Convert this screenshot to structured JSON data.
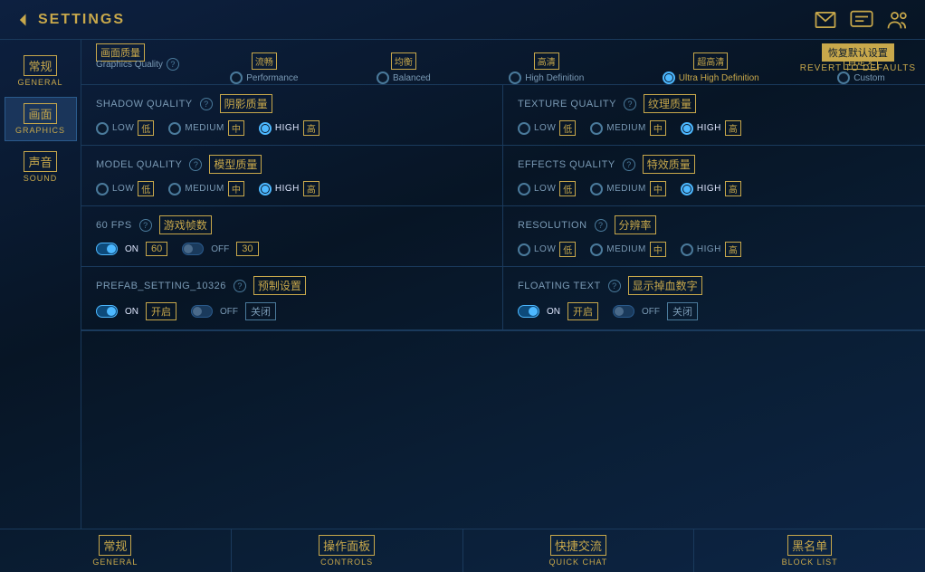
{
  "header": {
    "back_label": "SETTINGS",
    "revert_cn": "恢复默认设置",
    "revert_en": "REVERT TO DEFAULTS"
  },
  "quality_bar": {
    "label_cn": "画面质量",
    "label_en": "Graphics Quality",
    "options": [
      {
        "cn": "流畅",
        "en": "Performance",
        "active": false
      },
      {
        "cn": "均衡",
        "en": "Balanced",
        "active": false
      },
      {
        "cn": "高清",
        "en": "High Definition",
        "active": false
      },
      {
        "cn": "超高清",
        "en": "Ultra High Definition",
        "active": true
      },
      {
        "cn": "自定义",
        "en": "Custom",
        "active": false
      }
    ]
  },
  "sidebar": {
    "items": [
      {
        "cn": "常规",
        "en": "GENERAL",
        "active": false
      },
      {
        "cn": "画面",
        "en": "GRAPHICS",
        "active": true
      },
      {
        "cn": "声音",
        "en": "SOUND",
        "active": false
      }
    ]
  },
  "settings": [
    {
      "name_en": "SHADOW QUALITY",
      "name_cn": "阴影质量",
      "options": [
        {
          "en": "LOW",
          "cn": "低",
          "active": false
        },
        {
          "en": "MEDIUM",
          "cn": "中",
          "active": false
        },
        {
          "en": "HIGH",
          "cn": "高",
          "active": true
        }
      ]
    },
    {
      "name_en": "TEXTURE QUALITY",
      "name_cn": "纹理质量",
      "options": [
        {
          "en": "LOW",
          "cn": "低",
          "active": false
        },
        {
          "en": "MEDIUM",
          "cn": "中",
          "active": false
        },
        {
          "en": "HIGH",
          "cn": "高",
          "active": true
        }
      ]
    },
    {
      "name_en": "MODEL QUALITY",
      "name_cn": "模型质量",
      "options": [
        {
          "en": "LOW",
          "cn": "低",
          "active": false
        },
        {
          "en": "MEDIUM",
          "cn": "中",
          "active": false
        },
        {
          "en": "HIGH",
          "cn": "高",
          "active": true
        }
      ]
    },
    {
      "name_en": "EFFECTS QUALITY",
      "name_cn": "特效质量",
      "options": [
        {
          "en": "LOW",
          "cn": "低",
          "active": false
        },
        {
          "en": "MEDIUM",
          "cn": "中",
          "active": false
        },
        {
          "en": "HIGH",
          "cn": "高",
          "active": true
        }
      ]
    },
    {
      "name_en": "60 FPS",
      "name_cn": "游戏帧数",
      "type": "fps",
      "options": [
        {
          "en": "ON",
          "value": "60",
          "active": true
        },
        {
          "en": "OFF",
          "value": "30",
          "active": false
        }
      ]
    },
    {
      "name_en": "RESOLUTION",
      "name_cn": "分辨率",
      "options": [
        {
          "en": "LOW",
          "cn": "低",
          "active": false
        },
        {
          "en": "MEDIUM",
          "cn": "中",
          "active": false
        },
        {
          "en": "HIGH",
          "cn": "高",
          "active": false
        }
      ]
    },
    {
      "name_en": "PREFAB_SETTING_10326",
      "name_cn": "预制设置",
      "type": "toggle",
      "options": [
        {
          "en": "ON",
          "cn": "开启",
          "active": true
        },
        {
          "en": "OFF",
          "cn": "关闭",
          "active": false
        }
      ]
    },
    {
      "name_en": "FLOATING TEXT",
      "name_cn": "显示掉血数字",
      "type": "toggle",
      "options": [
        {
          "en": "ON",
          "cn": "开启",
          "active": true
        },
        {
          "en": "OFF",
          "cn": "关闭",
          "active": false
        }
      ]
    }
  ],
  "bottom_nav": [
    {
      "cn": "常规",
      "en": "GENERAL"
    },
    {
      "cn": "操作面板",
      "en": "CONTROLS"
    },
    {
      "cn": "快捷交流",
      "en": "QUICK CHAT"
    },
    {
      "cn": "黑名单",
      "en": "BLOCK LIST"
    }
  ]
}
